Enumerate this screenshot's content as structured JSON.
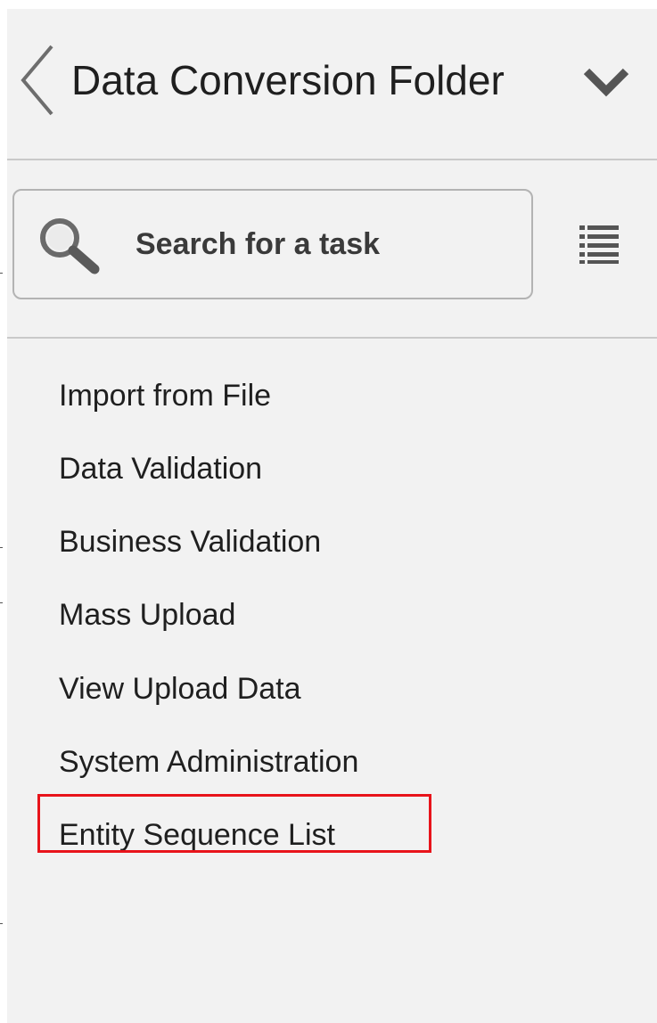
{
  "header": {
    "title": "Data Conversion Folder",
    "back_icon": "chevron-left-icon",
    "expand_icon": "chevron-down-icon"
  },
  "search": {
    "placeholder": "Search for a task",
    "value": "",
    "icon": "search-icon"
  },
  "list_view_icon": "list-view-icon",
  "tasks": [
    {
      "label": "Import from File"
    },
    {
      "label": "Data Validation"
    },
    {
      "label": "Business Validation"
    },
    {
      "label": "Mass Upload"
    },
    {
      "label": "View Upload Data"
    },
    {
      "label": "System Administration"
    },
    {
      "label": "Entity Sequence List",
      "highlighted": true
    }
  ],
  "colors": {
    "panel_bg": "#f2f2f2",
    "text": "#1f1f1f",
    "highlight": "#e8141b",
    "icon": "#555555"
  }
}
